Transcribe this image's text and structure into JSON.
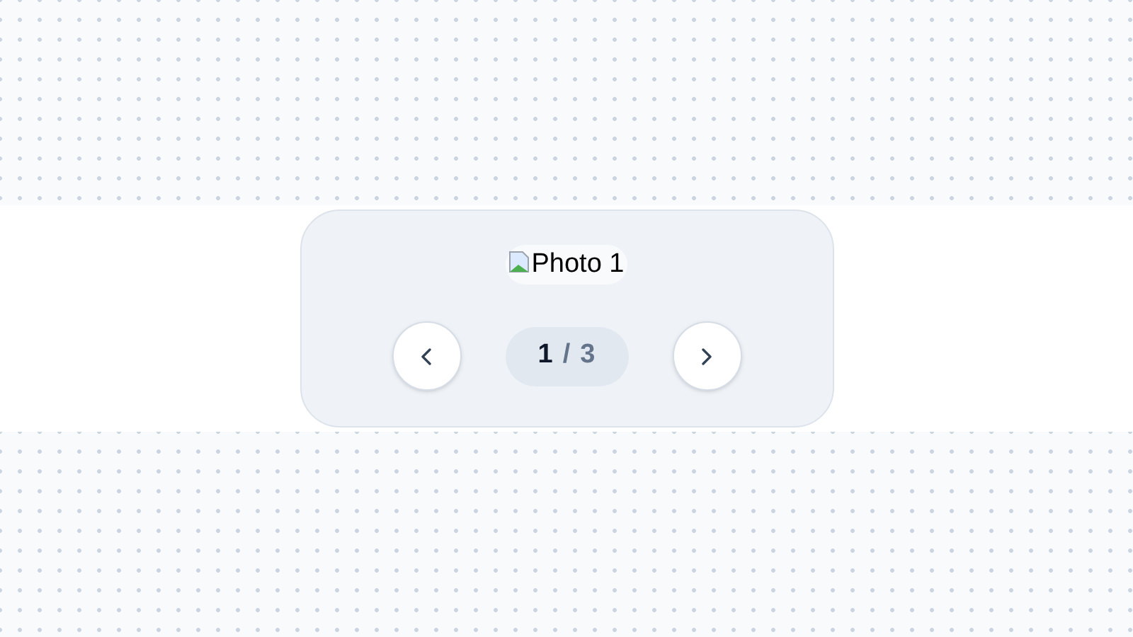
{
  "photo": {
    "alt": "Photo 1"
  },
  "pager": {
    "current": "1",
    "separator": "/",
    "total": "3"
  }
}
